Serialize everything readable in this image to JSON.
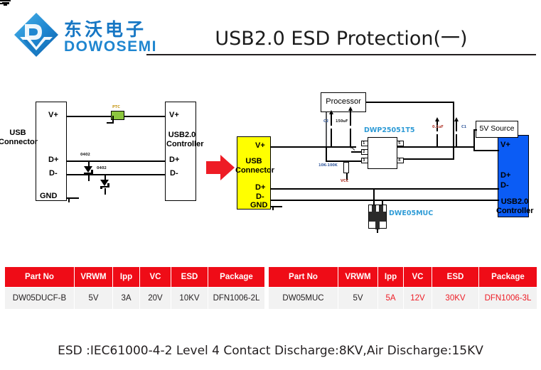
{
  "header": {
    "logo_cn": "东沃电子",
    "logo_en": "DOWOSEMI",
    "logo_icon": "dowosemi-diamond-logo",
    "title": "USB2.0 ESD Protection(一)"
  },
  "left_circuit": {
    "usb_connector": "USB\nConnector",
    "usb_connector_l1": "USB",
    "usb_connector_l2": "Connector",
    "controller_l1": "USB2.0",
    "controller_l2": "Controller",
    "pins": {
      "vplus": "V+",
      "dplus": "D+",
      "dminus": "D-",
      "gnd": "GND"
    },
    "ptc_label": "PTC",
    "diode1_label": "0402",
    "diode2_label": "0402"
  },
  "arrow": {
    "name": "red-right-arrow"
  },
  "right_circuit": {
    "usb_connector_l1": "USB",
    "usb_connector_l2": "Connector",
    "controller_l1": "USB2.0",
    "controller_l2": "Controller",
    "processor": "Processor",
    "source_5v": "5V Source",
    "ic_ref": "DWP25051T5",
    "ic_pins": [
      "1",
      "2",
      "3",
      "5",
      "4"
    ],
    "tvs_ref": "DWE05MUC",
    "cap_c2_ref": "C2",
    "cap_c2_val": "150uF",
    "cap_c1_ref": "C1",
    "cap_c1_val": "0.1uF",
    "resistor_val": "10K-100K",
    "vcc_label": "VCC",
    "pins": {
      "vplus": "V+",
      "dplus": "D+",
      "dminus": "D-",
      "gnd": "GND"
    }
  },
  "table_left": {
    "headers": [
      "Part No",
      "VRWM",
      "Ipp",
      "VC",
      "ESD",
      "Package"
    ],
    "rows": [
      {
        "part_no": "DW05DUCF-B",
        "vrwm": "5V",
        "ipp": "3A",
        "vc": "20V",
        "esd": "10KV",
        "package": "DFN1006-2L"
      }
    ]
  },
  "table_right": {
    "headers": [
      "Part No",
      "VRWM",
      "Ipp",
      "VC",
      "ESD",
      "Package"
    ],
    "rows": [
      {
        "part_no": "DW05MUC",
        "vrwm": "5V",
        "ipp": "5A",
        "vc": "12V",
        "esd": "30KV",
        "package": "DFN1006-3L"
      }
    ]
  },
  "footer": "ESD :IEC61000-4-2 Level 4 Contact Discharge:8KV,Air Discharge:15KV",
  "colors": {
    "brand_blue": "#1f86d0",
    "table_header_red": "#ef0c17",
    "accent_red": "#ee1c25",
    "connector_yellow": "#ffff00",
    "controller_blue": "#0b5cf5",
    "ptc_green": "#8cc63e",
    "ic_ref_blue": "#2e9bd6"
  }
}
